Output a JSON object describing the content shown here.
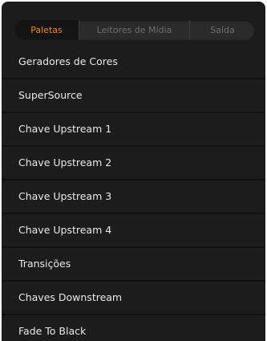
{
  "tabs": [
    {
      "label": "Paletas",
      "active": true
    },
    {
      "label": "Leitores de Mídia",
      "active": false
    },
    {
      "label": "Saída",
      "active": false
    }
  ],
  "menu": {
    "items": [
      {
        "label": "Geradores de Cores"
      },
      {
        "label": "SuperSource"
      },
      {
        "label": "Chave Upstream 1"
      },
      {
        "label": "Chave Upstream 2"
      },
      {
        "label": "Chave Upstream 3"
      },
      {
        "label": "Chave Upstream 4"
      },
      {
        "label": "Transições"
      },
      {
        "label": "Chaves Downstream"
      },
      {
        "label": "Fade To Black"
      }
    ]
  },
  "colors": {
    "accent": "#f28a1c",
    "panel": "#1c1c1c",
    "text": "#e8e8e8",
    "tab_inactive_text": "#6e6e6e"
  }
}
